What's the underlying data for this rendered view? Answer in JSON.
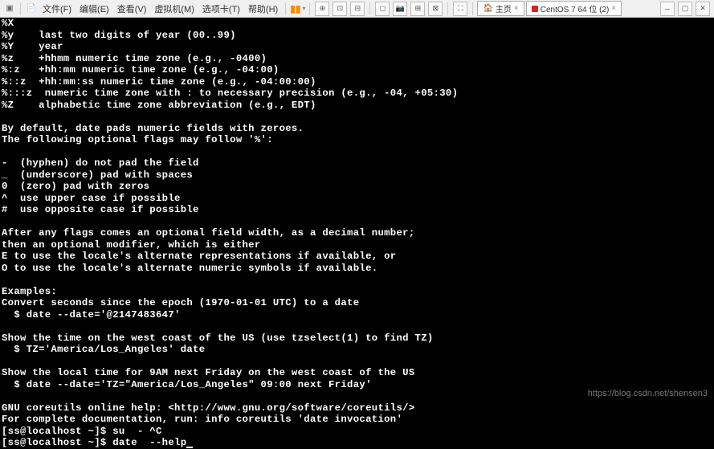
{
  "toolbar": {
    "menus": [
      "文件(F)",
      "编辑(E)",
      "查看(V)",
      "虚拟机(M)",
      "选项卡(T)",
      "帮助(H)"
    ],
    "home_label": "主页",
    "tab_label": "CentOS 7 64 位 (2)"
  },
  "term_lines": [
    "%X",
    "%y    last two digits of year (00..99)",
    "%Y    year",
    "%z    +hhmm numeric time zone (e.g., -0400)",
    "%:z   +hh:mm numeric time zone (e.g., -04:00)",
    "%::z  +hh:mm:ss numeric time zone (e.g., -04:00:00)",
    "%:::z  numeric time zone with : to necessary precision (e.g., -04, +05:30)",
    "%Z    alphabetic time zone abbreviation (e.g., EDT)",
    "",
    "By default, date pads numeric fields with zeroes.",
    "The following optional flags may follow '%':",
    "",
    "-  (hyphen) do not pad the field",
    "_  (underscore) pad with spaces",
    "0  (zero) pad with zeros",
    "^  use upper case if possible",
    "#  use opposite case if possible",
    "",
    "After any flags comes an optional field width, as a decimal number;",
    "then an optional modifier, which is either",
    "E to use the locale's alternate representations if available, or",
    "O to use the locale's alternate numeric symbols if available.",
    "",
    "Examples:",
    "Convert seconds since the epoch (1970-01-01 UTC) to a date",
    "  $ date --date='@2147483647'",
    "",
    "Show the time on the west coast of the US (use tzselect(1) to find TZ)",
    "  $ TZ='America/Los_Angeles' date",
    "",
    "Show the local time for 9AM next Friday on the west coast of the US",
    "  $ date --date='TZ=\"America/Los_Angeles\" 09:00 next Friday'",
    "",
    "GNU coreutils online help: <http://www.gnu.org/software/coreutils/>",
    "For complete documentation, run: info coreutils 'date invocation'",
    "[ss@localhost ~]$ su  - ^C",
    "[ss@localhost ~]$ date  --help"
  ],
  "watermark": "https://blog.csdn.net/shensen3"
}
